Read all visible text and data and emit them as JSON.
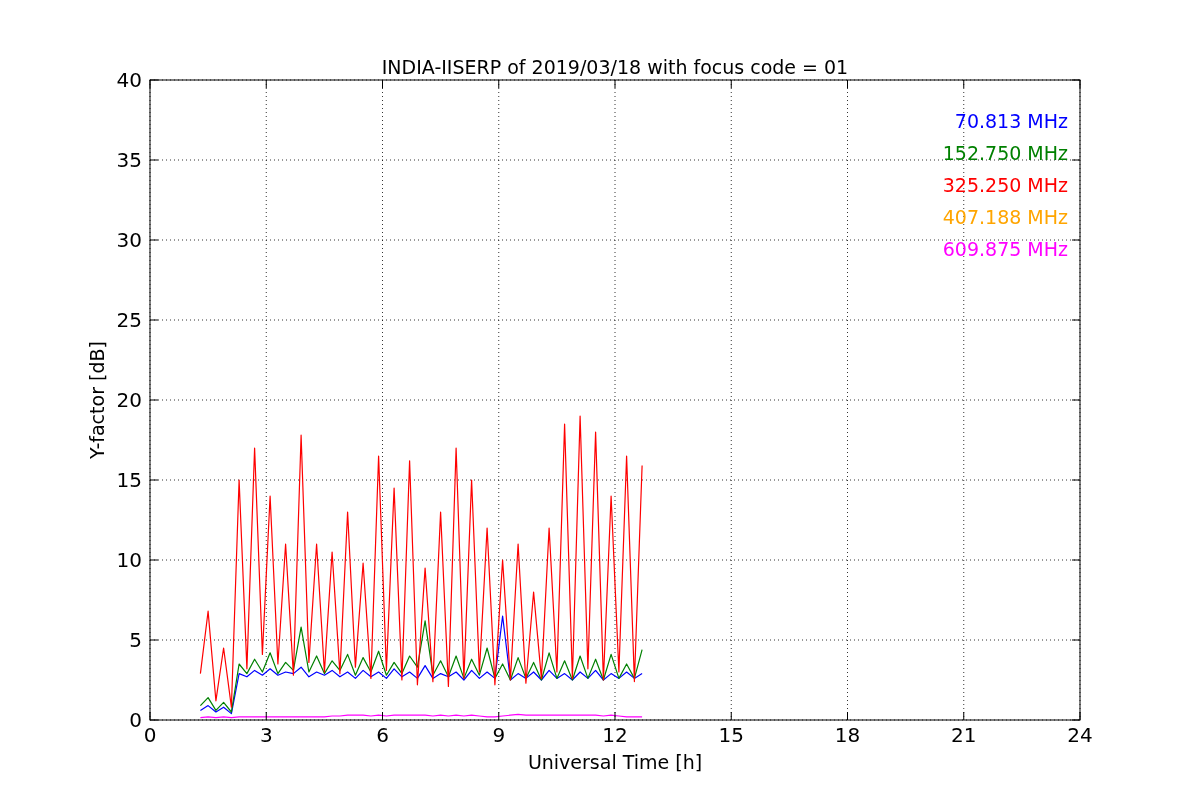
{
  "figure": {
    "chart_data": {
      "type": "line",
      "title": "INDIA-IISERP of 2019/03/18 with focus code = 01",
      "xlabel": "Universal Time [h]",
      "ylabel": "Y-factor [dB]",
      "xlim": [
        0,
        24
      ],
      "ylim": [
        0,
        40
      ],
      "grid": true,
      "xticks": [
        0,
        3,
        6,
        9,
        12,
        15,
        18,
        21,
        24
      ],
      "yticks": [
        0,
        5,
        10,
        15,
        20,
        25,
        30,
        35,
        40
      ],
      "x": [
        1.3,
        1.5,
        1.7,
        1.9,
        2.1,
        2.3,
        2.5,
        2.7,
        2.9,
        3.1,
        3.3,
        3.5,
        3.7,
        3.9,
        4.1,
        4.3,
        4.5,
        4.7,
        4.9,
        5.1,
        5.3,
        5.5,
        5.7,
        5.9,
        6.1,
        6.3,
        6.5,
        6.7,
        6.9,
        7.1,
        7.3,
        7.5,
        7.7,
        7.9,
        8.1,
        8.3,
        8.5,
        8.7,
        8.9,
        9.1,
        9.3,
        9.5,
        9.7,
        9.9,
        10.1,
        10.3,
        10.5,
        10.7,
        10.9,
        11.1,
        11.3,
        11.5,
        11.7,
        11.9,
        12.1,
        12.3,
        12.5,
        12.7
      ],
      "series": [
        {
          "name": "70.813 MHz",
          "color": "#0000ff",
          "values": [
            0.6,
            0.9,
            0.5,
            0.8,
            0.4,
            2.9,
            2.7,
            3.1,
            2.8,
            3.2,
            2.8,
            3.0,
            2.9,
            3.3,
            2.7,
            3.0,
            2.8,
            3.1,
            2.7,
            3.0,
            2.6,
            3.1,
            2.7,
            3.0,
            2.6,
            3.2,
            2.7,
            3.0,
            2.6,
            3.4,
            2.6,
            2.9,
            2.7,
            3.0,
            2.5,
            3.1,
            2.6,
            3.0,
            2.6,
            6.5,
            2.5,
            2.9,
            2.6,
            3.0,
            2.5,
            3.1,
            2.6,
            2.9,
            2.5,
            3.0,
            2.6,
            3.1,
            2.5,
            2.9,
            2.6,
            3.0,
            2.6,
            2.9
          ]
        },
        {
          "name": "152.750 MHz",
          "color": "#008000",
          "values": [
            0.9,
            1.4,
            0.6,
            1.1,
            0.5,
            3.5,
            2.9,
            3.8,
            3.0,
            4.2,
            2.9,
            3.6,
            3.1,
            5.8,
            3.0,
            4.0,
            2.9,
            3.7,
            3.1,
            4.1,
            2.8,
            3.9,
            3.0,
            4.3,
            2.8,
            3.6,
            2.9,
            4.0,
            3.3,
            6.2,
            2.8,
            3.7,
            2.7,
            4.0,
            2.6,
            3.8,
            2.8,
            4.5,
            2.6,
            3.5,
            2.5,
            3.9,
            2.6,
            3.6,
            2.5,
            4.2,
            2.6,
            3.7,
            2.5,
            4.0,
            2.6,
            3.8,
            2.5,
            4.1,
            2.6,
            3.5,
            2.6,
            4.4
          ]
        },
        {
          "name": "325.250 MHz",
          "color": "#ff0000",
          "values": [
            2.9,
            6.8,
            1.2,
            4.5,
            0.8,
            15,
            3.2,
            17,
            4.1,
            14,
            3.5,
            11,
            2.8,
            17.8,
            3.6,
            11,
            3.0,
            10.5,
            2.9,
            13,
            3.3,
            9.8,
            2.6,
            16.5,
            3.1,
            14.5,
            2.5,
            16.2,
            2.2,
            9.5,
            2.4,
            13,
            2.1,
            17,
            2.6,
            15,
            3.0,
            12,
            2.2,
            10,
            2.5,
            11,
            2.3,
            8,
            2.6,
            12,
            3.0,
            18.5,
            2.6,
            19,
            3.2,
            18,
            2.5,
            14,
            3.0,
            16.5,
            2.4,
            15.9
          ]
        },
        {
          "name": "407.188 MHz",
          "color": "#ffa500",
          "values": [
            null,
            null,
            null,
            null,
            null,
            null,
            null,
            null,
            null,
            null,
            null,
            null,
            null,
            null,
            null,
            null,
            null,
            null,
            null,
            null,
            null,
            null,
            null,
            null,
            null,
            null,
            null,
            null,
            null,
            null,
            null,
            null,
            null,
            null,
            null,
            null,
            null,
            null,
            null,
            null,
            null,
            null,
            null,
            null,
            null,
            null,
            null,
            null,
            null,
            null,
            null,
            null,
            null,
            null,
            null,
            null,
            null,
            null
          ]
        },
        {
          "name": "609.875 MHz",
          "color": "#ff00ff",
          "values": [
            0.15,
            0.2,
            0.15,
            0.2,
            0.15,
            0.2,
            0.2,
            0.2,
            0.2,
            0.2,
            0.2,
            0.2,
            0.2,
            0.2,
            0.2,
            0.2,
            0.2,
            0.25,
            0.25,
            0.3,
            0.3,
            0.3,
            0.25,
            0.3,
            0.25,
            0.3,
            0.3,
            0.3,
            0.3,
            0.3,
            0.25,
            0.3,
            0.25,
            0.3,
            0.25,
            0.3,
            0.25,
            0.2,
            0.2,
            0.25,
            0.3,
            0.35,
            0.3,
            0.3,
            0.3,
            0.3,
            0.3,
            0.3,
            0.3,
            0.3,
            0.3,
            0.3,
            0.25,
            0.3,
            0.25,
            0.2,
            0.2,
            0.2
          ]
        }
      ]
    }
  }
}
